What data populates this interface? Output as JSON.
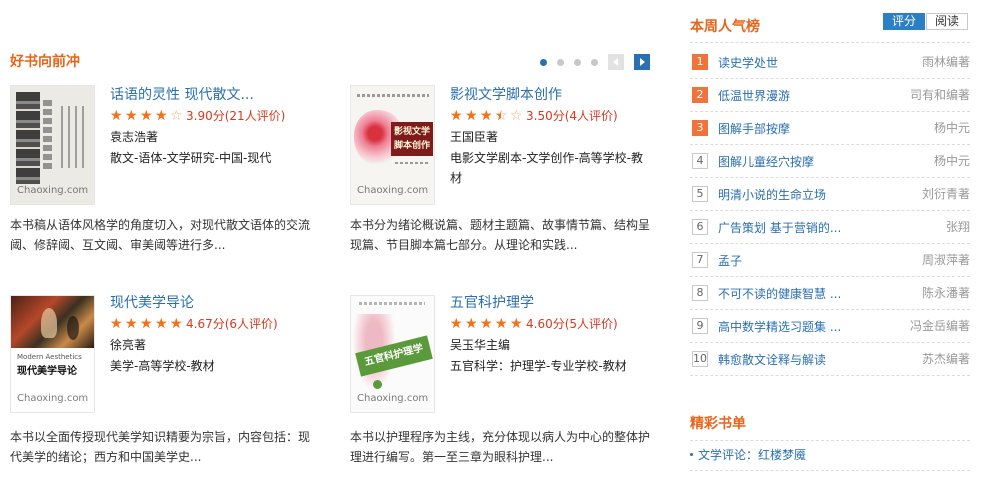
{
  "colors": {
    "accent": "#e8641b",
    "link": "#2a6fb0",
    "score": "#d9381e",
    "star": "#f2711c",
    "muted": "#999999",
    "tab_active": "#2b80c5",
    "badge_top": "#f0733a"
  },
  "featured": {
    "title": "好书向前冲",
    "carousel": {
      "page_count": 4,
      "active_page": 1,
      "prev_icon": "chevron-left-icon",
      "next_icon": "chevron-right-icon"
    },
    "cover_watermark": "Chaoxing.com",
    "books": [
      {
        "title": "话语的灵性 现代散文...",
        "stars": 4,
        "score_text": "3.90分(21人评价)",
        "author": "袁志浩著",
        "category": "散文-语体-文学研究-中国-现代",
        "description": "本书稿从语体风格学的角度切入，对现代散文语体的交流阈、修辞阈、互文阈、审美阈等进行多..."
      },
      {
        "title": "影视文学脚本创作",
        "stars": 3.5,
        "score_text": "3.50分(4人评价)",
        "author": "王国臣著",
        "category": "电影文学剧本-文学创作-高等学校-教材",
        "description": "本书分为绪论概说篇、题材主题篇、故事情节篇、结构呈现篇、节目脚本篇七部分。从理论和实践...",
        "cover_lines": [
          "影视文学",
          "脚本创作"
        ]
      },
      {
        "title": "现代美学导论",
        "stars": 5,
        "score_text": "4.67分(6人评价)",
        "author": "徐亮著",
        "category": "美学-高等学校-教材",
        "description": "本书以全面传授现代美学知识精要为宗旨，内容包括：现代美学的绪论；西方和中国美学史...",
        "cover_subtitle": "Modern Aesthetics",
        "cover_title": "现代美学导论"
      },
      {
        "title": "五官科护理学",
        "stars": 5,
        "score_text": "4.60分(5人评价)",
        "author": "吴玉华主编",
        "category": "五官科学：护理学-专业学校-教材",
        "description": "本书以护理程序为主线，充分体现以病人为中心的整体护理进行编写。第一至三章为眼科护理...",
        "cover_title": "五官科护理学"
      }
    ]
  },
  "ranking": {
    "title": "本周人气榜",
    "tabs": [
      "评分",
      "阅读"
    ],
    "active_tab": "评分",
    "items": [
      {
        "rank": "1",
        "title": "读史学处世",
        "author": "雨林编著"
      },
      {
        "rank": "2",
        "title": "低温世界漫游",
        "author": "司有和编著"
      },
      {
        "rank": "3",
        "title": "图解手部按摩",
        "author": "杨中元"
      },
      {
        "rank": "4",
        "title": "图解儿童经穴按摩",
        "author": "杨中元"
      },
      {
        "rank": "5",
        "title": "明清小说的生命立场",
        "author": "刘衍青著"
      },
      {
        "rank": "6",
        "title": "广告策划 基于营销的...",
        "author": "张翔"
      },
      {
        "rank": "7",
        "title": "孟子",
        "author": "周淑萍著"
      },
      {
        "rank": "8",
        "title": "不可不读的健康智慧 ...",
        "author": "陈永潘著"
      },
      {
        "rank": "9",
        "title": "高中数学精选习题集 ...",
        "author": "冯金岳编著"
      },
      {
        "rank": "10",
        "title": "韩愈散文诠释与解读",
        "author": "苏杰编著"
      }
    ]
  },
  "booklist": {
    "title": "精彩书单",
    "items": [
      "文学评论：红楼梦魇"
    ]
  }
}
